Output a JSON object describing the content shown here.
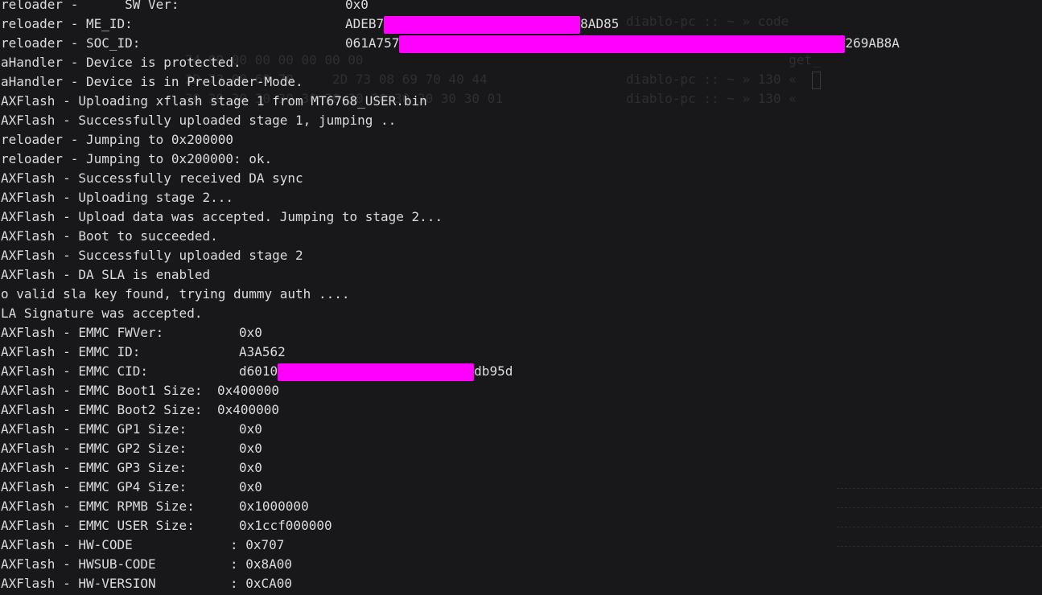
{
  "theme": {
    "background": "#18181b",
    "foreground": "#dcdcdc",
    "redaction": "#ff00ff",
    "ghost": "#2e2e33"
  },
  "ghost": {
    "right_lines": [
      "diablo-pc :: ~ » code",
      "diablo-pc :: ~ » 130 «",
      "                     get_",
      "diablo-pc :: ~ » 130 «",
      "diablo-pc :: ~ » 130 «"
    ],
    "hex_lines": [
      "74 00 00 00 00 00 00 00",
      "2D 73 08 69 70     2D 73 08 69 70 40 44",
      "30 30 30 30 30 30 30 30 30 30 30 30 30 01"
    ]
  },
  "lines": [
    {
      "prefix": "reloader -      SW Ver:",
      "value": "0x0",
      "value_col": 428
    },
    {
      "prefix": "reloader - ME_ID:",
      "value": "ADEB7",
      "value_col": 428,
      "redact_width": 244,
      "suffix": "8AD85"
    },
    {
      "prefix": "reloader - SOC_ID:",
      "value": "061A757",
      "value_col": 428,
      "redact_width": 554,
      "suffix": "269AB8A"
    },
    {
      "prefix": "aHandler - Device is protected."
    },
    {
      "prefix": "aHandler - Device is in Preloader-Mode."
    },
    {
      "prefix": "AXFlash - Uploading xflash stage 1 from MT6768_USER.bin"
    },
    {
      "prefix": "AXFlash - Successfully uploaded stage 1, jumping .."
    },
    {
      "prefix": "reloader - Jumping to 0x200000"
    },
    {
      "prefix": "reloader - Jumping to 0x200000: ok."
    },
    {
      "prefix": "AXFlash - Successfully received DA sync"
    },
    {
      "prefix": "AXFlash - Uploading stage 2..."
    },
    {
      "prefix": "AXFlash - Upload data was accepted. Jumping to stage 2..."
    },
    {
      "prefix": "AXFlash - Boot to succeeded."
    },
    {
      "prefix": "AXFlash - Successfully uploaded stage 2"
    },
    {
      "prefix": "AXFlash - DA SLA is enabled"
    },
    {
      "prefix": "o valid sla key found, trying dummy auth ...."
    },
    {
      "prefix": "LA Signature was accepted."
    },
    {
      "prefix": "AXFlash - EMMC FWVer:",
      "value": "0x0",
      "value_col": 296
    },
    {
      "prefix": "AXFlash - EMMC ID:",
      "value": "A3A562",
      "value_col": 296
    },
    {
      "prefix": "AXFlash - EMMC CID:",
      "value": "d6010",
      "value_col": 296,
      "redact_width": 244,
      "suffix": "db95d"
    },
    {
      "prefix": "AXFlash - EMMC Boot1 Size:",
      "value": "0x400000",
      "value_col": 269
    },
    {
      "prefix": "AXFlash - EMMC Boot2 Size:",
      "value": "0x400000",
      "value_col": 269
    },
    {
      "prefix": "AXFlash - EMMC GP1 Size:",
      "value": "0x0",
      "value_col": 296
    },
    {
      "prefix": "AXFlash - EMMC GP2 Size:",
      "value": "0x0",
      "value_col": 296
    },
    {
      "prefix": "AXFlash - EMMC GP3 Size:",
      "value": "0x0",
      "value_col": 296
    },
    {
      "prefix": "AXFlash - EMMC GP4 Size:",
      "value": "0x0",
      "value_col": 296
    },
    {
      "prefix": "AXFlash - EMMC RPMB Size:",
      "value": "0x1000000",
      "value_col": 296
    },
    {
      "prefix": "AXFlash - EMMC USER Size:",
      "value": "0x1ccf000000",
      "value_col": 296
    },
    {
      "prefix": "AXFlash - HW-CODE",
      "value": ": 0x707",
      "value_col": 285
    },
    {
      "prefix": "AXFlash - HWSUB-CODE",
      "value": ": 0x8A00",
      "value_col": 285
    },
    {
      "prefix": "AXFlash - HW-VERSION",
      "value": ": 0xCA00",
      "value_col": 285
    }
  ]
}
